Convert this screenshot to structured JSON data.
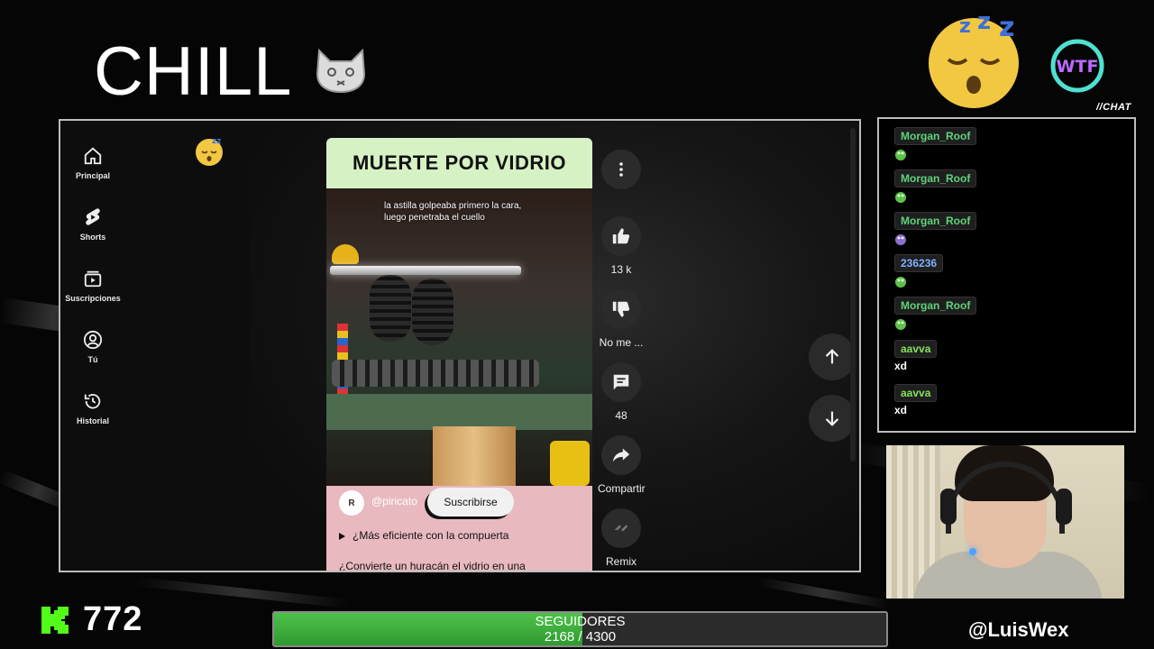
{
  "overlay": {
    "title": "CHILL",
    "chat_tag": "//CHAT",
    "wtf_badge": "WTF",
    "kick_count": "772",
    "handle": "@LuisWex",
    "followers": {
      "label": "SEGUIDORES",
      "current": "2168",
      "goal": "4300",
      "separator": " / ",
      "progress": 0.504
    }
  },
  "sidebar": {
    "items": [
      {
        "label": "Principal",
        "icon": "home-icon"
      },
      {
        "label": "Shorts",
        "icon": "shorts-icon"
      },
      {
        "label": "Suscripciones",
        "icon": "subscriptions-icon"
      },
      {
        "label": "Tú",
        "icon": "user-icon"
      },
      {
        "label": "Historial",
        "icon": "history-icon"
      }
    ]
  },
  "short": {
    "title": "MUERTE POR VIDRIO",
    "caption": "la astilla golpeaba primero la cara, luego penetraba el cuello",
    "channel_avatar": "R",
    "channel": "@piricato",
    "subscribe_label": "Suscribirse",
    "description_line1": "¿Más eficiente con la compuerta",
    "description_line2": "¿Convierte un huracán el vidrio en una"
  },
  "actions": {
    "like_count": "13 k",
    "dislike_label": "No me ...",
    "comments_count": "48",
    "share_label": "Compartir",
    "remix_label": "Remix"
  },
  "chat": {
    "messages": [
      {
        "user": "Morgan_Roof",
        "color": "#5fd37a",
        "text": ""
      },
      {
        "user": "Morgan_Roof",
        "color": "#5fd37a",
        "text": ""
      },
      {
        "user": "Morgan_Roof",
        "color": "#5fd37a",
        "text": ""
      },
      {
        "user": "236236",
        "color": "#7fb0ff",
        "text": ""
      },
      {
        "user": "Morgan_Roof",
        "color": "#5fd37a",
        "text": ""
      },
      {
        "user": "aavva",
        "color": "#86e05b",
        "text": "xd"
      },
      {
        "user": "aavva",
        "color": "#86e05b",
        "text": "xd"
      }
    ]
  },
  "colors": {
    "kick_green": "#53fc18",
    "followers_fill": "#3fb43c",
    "chat_border": "#bdbdbd"
  }
}
